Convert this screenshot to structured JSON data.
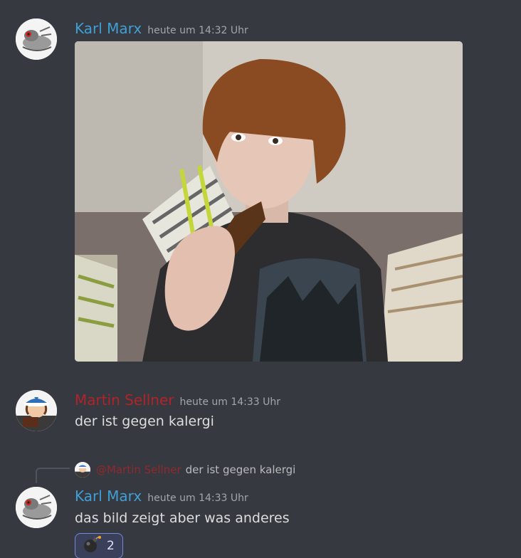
{
  "messages": [
    {
      "author": "Karl Marx",
      "timestamp": "heute um 14:32 Uhr",
      "attachment": "image",
      "avatar_icon": "gecko-drawing-avatar-icon"
    },
    {
      "author": "Martin Sellner",
      "timestamp": "heute um 14:33 Uhr",
      "text": "der ist gegen kalergi",
      "avatar_icon": "cartoon-kid-avatar-icon"
    },
    {
      "reply": {
        "mention": "@Martin Sellner",
        "text": "der ist gegen kalergi"
      },
      "author": "Karl Marx",
      "timestamp": "heute um 14:33 Uhr",
      "text": "das bild zeigt aber was anderes",
      "avatar_icon": "gecko-drawing-avatar-icon",
      "reaction": {
        "emoji": "bomb-icon",
        "count": "2"
      }
    }
  ],
  "colors": {
    "background": "#36393f",
    "author_blue": "#3f9fd6",
    "author_red": "#b0242a",
    "timestamp": "#a3a6aa",
    "reaction_border": "#7289da"
  }
}
